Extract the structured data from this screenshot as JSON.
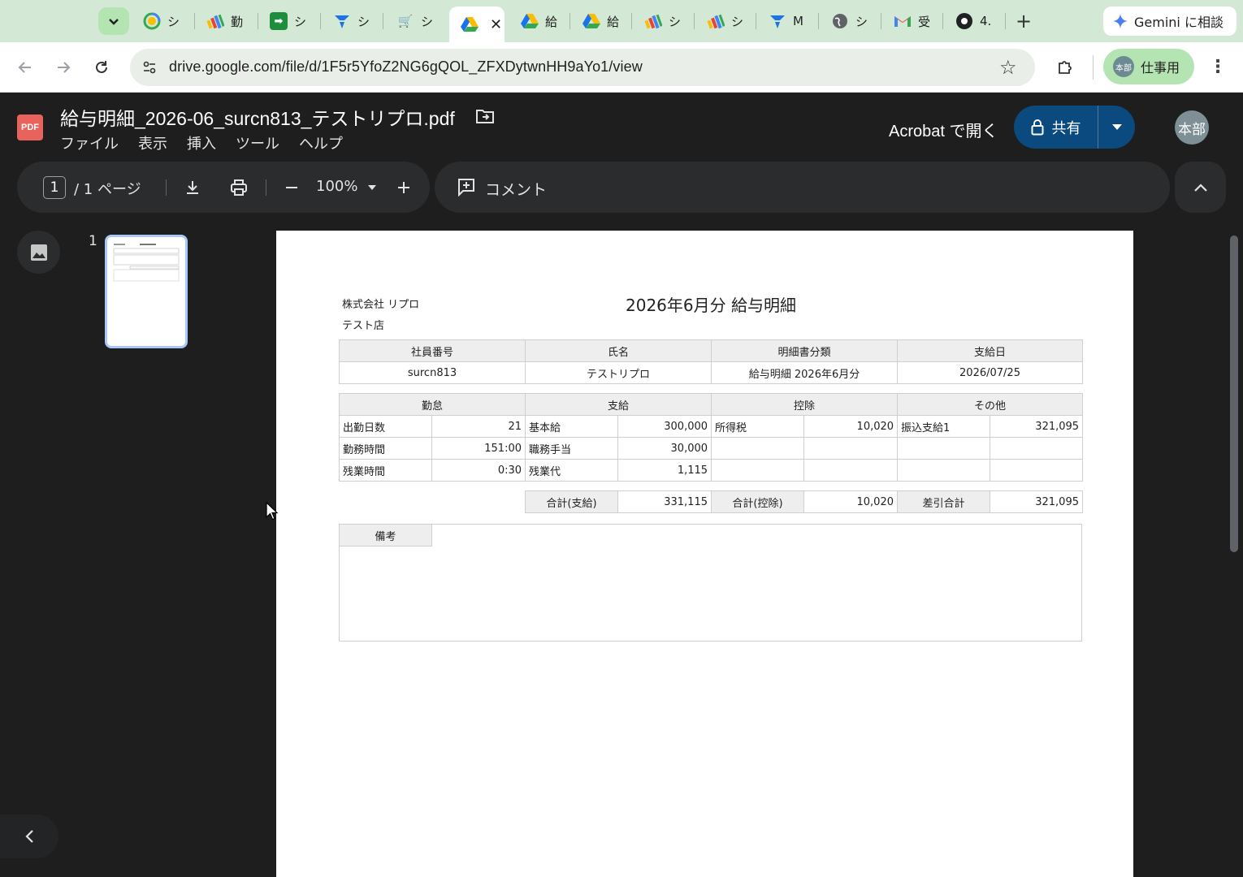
{
  "browser": {
    "tabs": [
      {
        "icon": "google-photos-icon",
        "label": "シ"
      },
      {
        "icon": "colorful-app-icon",
        "label": "勤"
      },
      {
        "icon": "green-arrow-icon",
        "label": "シ"
      },
      {
        "icon": "blue-v-icon",
        "label": "シ"
      },
      {
        "icon": "cart-icon",
        "label": "シ"
      },
      {
        "icon": "google-drive-icon",
        "label": "",
        "active": true
      },
      {
        "icon": "google-drive-icon",
        "label": "給"
      },
      {
        "icon": "google-drive-icon",
        "label": "給"
      },
      {
        "icon": "colorful-app-icon",
        "label": "シ"
      },
      {
        "icon": "colorful-app-icon",
        "label": "シ"
      },
      {
        "icon": "blue-v-icon",
        "label": "M"
      },
      {
        "icon": "globe-icon",
        "label": "シ"
      },
      {
        "icon": "gmail-icon",
        "label": "受"
      },
      {
        "icon": "dark-circle-icon",
        "label": "4."
      }
    ],
    "gemini_label": "Gemini に相談",
    "url": "drive.google.com/file/d/1F5r5YfoZ2NG6gQOL_ZFXDytwnHH9aYo1/view",
    "profile_label": "仕事用",
    "profile_avatar": "本部"
  },
  "drive": {
    "file_title": "給与明細_2026-06_surcn813_テストリプロ.pdf",
    "menu": [
      "ファイル",
      "表示",
      "挿入",
      "ツール",
      "ヘルプ"
    ],
    "open_with": "Acrobat で開く",
    "share_label": "共有",
    "account_avatar": "本部",
    "current_page": "1",
    "page_of": "/  1  ページ",
    "zoom": "100%",
    "comment_label": "コメント",
    "thumb_number": "1"
  },
  "payslip": {
    "company": "株式会社 リプロ",
    "store": "テスト店",
    "title": "2026年6月分 給与明細",
    "info_headers": [
      "社員番号",
      "氏名",
      "明細書分類",
      "支給日"
    ],
    "info_values": [
      "surcn813",
      "テストリプロ",
      "給与明細 2026年6月分",
      "2026/07/25"
    ],
    "section_headers": [
      "勤怠",
      "支給",
      "控除",
      "その他"
    ],
    "rows": [
      [
        "出勤日数",
        "21",
        "基本給",
        "300,000",
        "所得税",
        "10,020",
        "振込支給1",
        "321,095"
      ],
      [
        "勤務時間",
        "151:00",
        "職務手当",
        "30,000",
        "",
        "",
        "",
        ""
      ],
      [
        "残業時間",
        "0:30",
        "残業代",
        "1,115",
        "",
        "",
        "",
        ""
      ]
    ],
    "totals": {
      "pay_label": "合計(支給)",
      "pay_value": "331,115",
      "deduction_label": "合計(控除)",
      "deduction_value": "10,020",
      "net_label": "差引合計",
      "net_value": "321,095"
    },
    "remarks_label": "備考"
  }
}
